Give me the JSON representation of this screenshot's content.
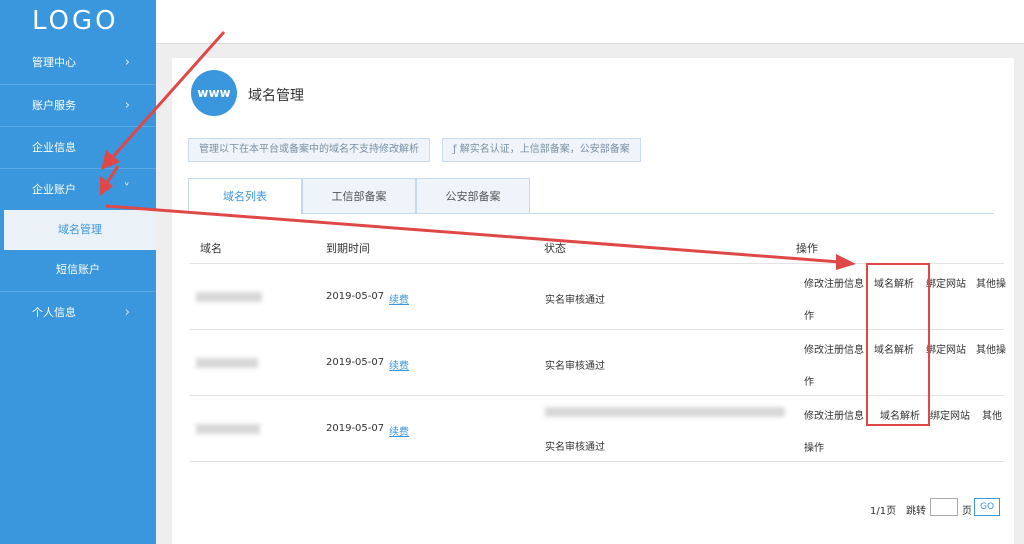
{
  "logo": "LOGO",
  "sidebar": {
    "items": [
      {
        "label": "管理中心",
        "chevron": "›"
      },
      {
        "label": "账户服务",
        "chevron": "›"
      },
      {
        "label": "企业信息"
      },
      {
        "label": "企业账户",
        "chevron": "˅"
      },
      {
        "label": "个人信息",
        "chevron": "›"
      }
    ],
    "subitems": [
      {
        "label": "域名管理"
      },
      {
        "label": "短信账户"
      }
    ]
  },
  "page": {
    "icon_text": "www",
    "title": "域名管理",
    "notice_left": "管理以下在本平台或备案中的域名不支持修改解析",
    "notice_right": "ƒ 解实名认证，上信部备案，公安部备案"
  },
  "tabs": [
    "域名列表",
    "工信部备案",
    "公安部备案"
  ],
  "table": {
    "headers": [
      "域名",
      "到期时间",
      "状态",
      "操作"
    ],
    "rows": [
      {
        "expire": "2019-05-07",
        "renew": "续费",
        "status": "实名审核通过",
        "ops": [
          "修改注册信息",
          "域名解析",
          "绑定网站",
          "其他操",
          "作"
        ]
      },
      {
        "expire": "2019-05-07",
        "renew": "续费",
        "status": "实名审核通过",
        "ops": [
          "修改注册信息",
          "域名解析",
          "绑定网站",
          "其他操",
          "作"
        ]
      },
      {
        "expire": "2019-05-07",
        "renew": "续费",
        "status": "实名审核通过",
        "ops": [
          "修改注册信息",
          "域名解析",
          "绑定网站",
          "其他",
          "操作"
        ]
      }
    ]
  },
  "pager": {
    "summary": "1/1页",
    "jump_label": "跳转",
    "page_unit": "页",
    "input_value": "",
    "go_label": "GO"
  },
  "colors": {
    "sidebar": "#3a96dd",
    "accent": "#3a96dd",
    "annotation": "#e04848"
  }
}
